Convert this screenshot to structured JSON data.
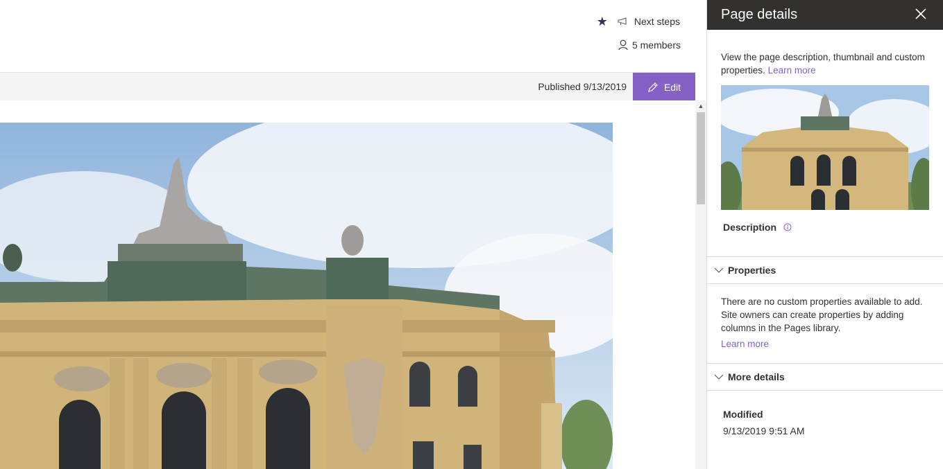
{
  "header": {
    "next_steps": "Next steps",
    "members": "5 members"
  },
  "commandbar": {
    "published": "Published 9/13/2019",
    "edit_label": "Edit"
  },
  "panel": {
    "title": "Page details",
    "intro_text": "View the page description, thumbnail and custom properties.",
    "intro_link": "Learn more",
    "description_label": "Description",
    "properties": {
      "header": "Properties",
      "text": "There are no custom properties available to add. Site owners can create properties by adding columns in the Pages library.",
      "link": "Learn more"
    },
    "more_details": {
      "header": "More details",
      "modified_label": "Modified",
      "modified_value": "9/13/2019 9:51 AM"
    }
  },
  "icons": [
    "favorite-star-icon",
    "megaphone-icon",
    "person-icon",
    "pencil-icon",
    "close-icon",
    "info-icon",
    "chevron-down-icon"
  ],
  "colors": {
    "accent": "#8661c5",
    "panel_header": "#323130",
    "link": "#8661c5"
  }
}
